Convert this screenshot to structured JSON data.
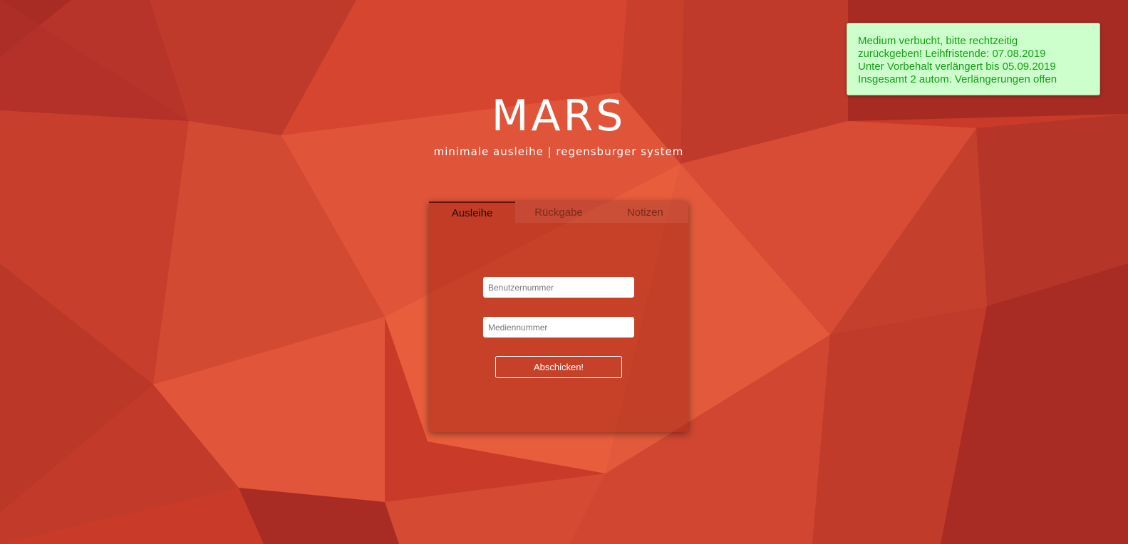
{
  "brand": {
    "title": "MARS",
    "subtitle": "minimale ausleihe | regensburger system"
  },
  "notice": {
    "lines": [
      "Medium verbucht, bitte rechtzeitig",
      "zurückgeben! Leihfristende: 07.08.2019",
      "Unter Vorbehalt verlängert bis 05.09.2019",
      "Insgesamt 2 autom. Verlängerungen offen"
    ],
    "colors": {
      "background": "#ccffcc",
      "text": "#14a014"
    }
  },
  "tabs": [
    {
      "label": "Ausleihe",
      "active": true
    },
    {
      "label": "Rückgabe",
      "active": false
    },
    {
      "label": "Notizen",
      "active": false
    }
  ],
  "form": {
    "user_placeholder": "Benutzernummer",
    "user_value": "",
    "media_placeholder": "Mediennummer",
    "media_value": "",
    "submit_label": "Abschicken!"
  },
  "colors": {
    "background": "#d2432b",
    "accent": "#f4583a"
  }
}
